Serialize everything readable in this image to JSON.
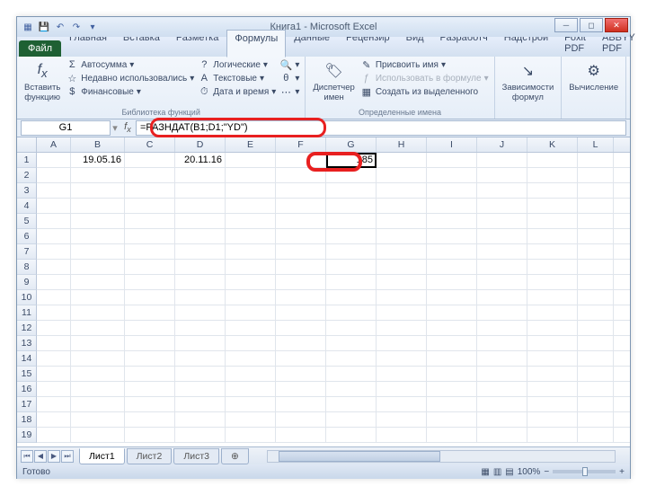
{
  "window": {
    "title": "Книга1 - Microsoft Excel"
  },
  "tabs": {
    "file": "Файл",
    "items": [
      "Главная",
      "Вставка",
      "Разметка",
      "Формулы",
      "Данные",
      "Рецензир",
      "Вид",
      "Разработч",
      "Надстрой",
      "Foxit PDF",
      "ABBYY PDF"
    ],
    "active_index": 3
  },
  "ribbon": {
    "insert_fn": {
      "label": "Вставить\nфункцию",
      "icon": "fx"
    },
    "lib_group_title": "Библиотека функций",
    "lib_col1": [
      "Автосумма",
      "Недавно использовались",
      "Финансовые"
    ],
    "lib_col2": [
      "Логические",
      "Текстовые",
      "Дата и время"
    ],
    "name_mgr": "Диспетчер\nимен",
    "names_group_title": "Определенные имена",
    "names_col": [
      "Присвоить имя",
      "Использовать в формуле",
      "Создать из выделенного"
    ],
    "dep": "Зависимости\nформул",
    "calc": "Вычисление"
  },
  "namebox": "G1",
  "formula": "=РАЗНДАТ(B1;D1;\"YD\")",
  "cols": [
    "A",
    "B",
    "C",
    "D",
    "E",
    "F",
    "G",
    "H",
    "I",
    "J",
    "K",
    "L"
  ],
  "cells": {
    "B1": "19.05.16",
    "D1": "20.11.16",
    "G1": "185"
  },
  "row_count": 19,
  "sheets": {
    "items": [
      "Лист1",
      "Лист2",
      "Лист3"
    ],
    "active_index": 0
  },
  "status": {
    "ready": "Готово",
    "zoom": "100%"
  }
}
